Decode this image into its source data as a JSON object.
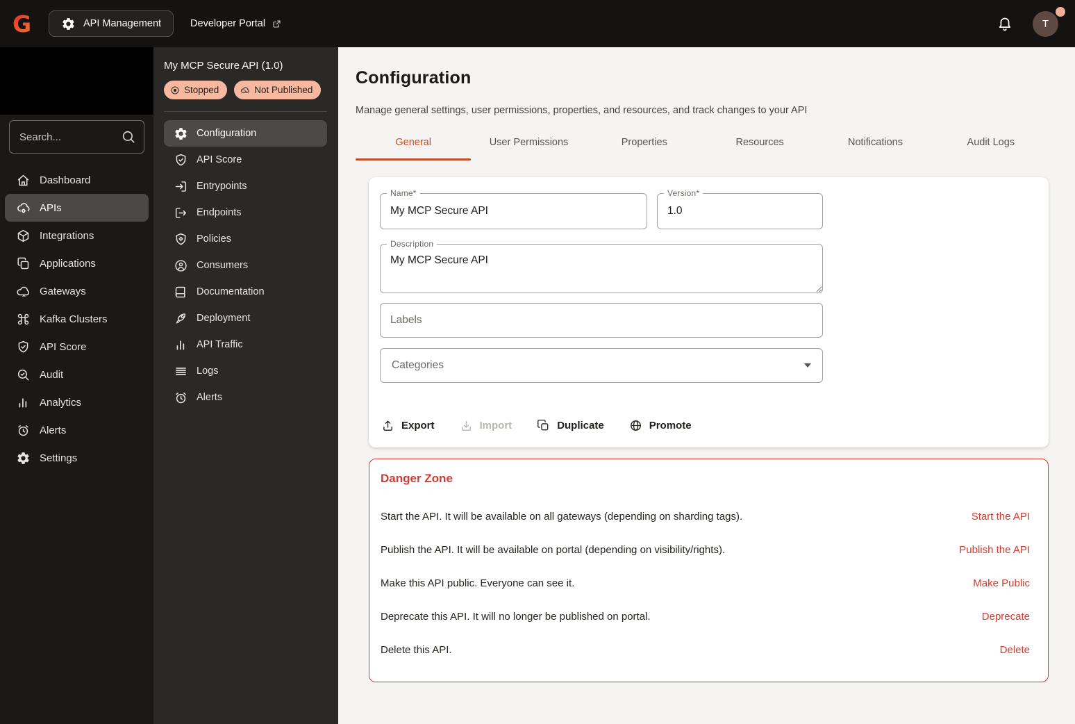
{
  "colors": {
    "accent_orange": "#c44e27",
    "danger_red": "#d23b30",
    "badge_bg": "#f6b9a0",
    "topbar_bg": "#151311",
    "sidebar_bg": "#1a1918",
    "subsidebar_bg": "#2b2928",
    "avatar_bg": "#5d4a42",
    "presence_dot": "#f2b094"
  },
  "topbar": {
    "logo_letter": "G",
    "app_switcher": {
      "label": "API Management",
      "icon": "gear"
    },
    "portal_link": {
      "label": "Developer Portal",
      "icon": "external-link"
    },
    "bell_icon": "bell",
    "avatar": {
      "initial": "T"
    }
  },
  "sidebar": {
    "search_placeholder": "Search...",
    "search_icon": "search",
    "items": [
      {
        "label": "Dashboard",
        "icon": "home",
        "active": false
      },
      {
        "label": "APIs",
        "icon": "cloud-gear",
        "active": true
      },
      {
        "label": "Integrations",
        "icon": "cube",
        "active": false
      },
      {
        "label": "Applications",
        "icon": "copies",
        "active": false
      },
      {
        "label": "Gateways",
        "icon": "cloud",
        "active": false
      },
      {
        "label": "Kafka Clusters",
        "icon": "command",
        "active": false
      },
      {
        "label": "API Score",
        "icon": "shield-check",
        "active": false
      },
      {
        "label": "Audit",
        "icon": "search-check",
        "active": false
      },
      {
        "label": "Analytics",
        "icon": "bar-chart",
        "active": false
      },
      {
        "label": "Alerts",
        "icon": "alarm",
        "active": false
      },
      {
        "label": "Settings",
        "icon": "gear",
        "active": false
      }
    ]
  },
  "api_menu": {
    "title": "My MCP Secure API (1.0)",
    "badges": [
      {
        "label": "Stopped",
        "icon": "stop-circle"
      },
      {
        "label": "Not Published",
        "icon": "cloud-off"
      }
    ],
    "items": [
      {
        "label": "Configuration",
        "icon": "gear",
        "active": true
      },
      {
        "label": "API Score",
        "icon": "shield-check",
        "active": false
      },
      {
        "label": "Entrypoints",
        "icon": "sign-in",
        "active": false
      },
      {
        "label": "Endpoints",
        "icon": "sign-out",
        "active": false
      },
      {
        "label": "Policies",
        "icon": "shield-gear",
        "active": false
      },
      {
        "label": "Consumers",
        "icon": "person",
        "active": false
      },
      {
        "label": "Documentation",
        "icon": "book",
        "active": false
      },
      {
        "label": "Deployment",
        "icon": "rocket",
        "active": false
      },
      {
        "label": "API Traffic",
        "icon": "bar-chart",
        "active": false
      },
      {
        "label": "Logs",
        "icon": "lines",
        "active": false
      },
      {
        "label": "Alerts",
        "icon": "alarm",
        "active": false
      }
    ]
  },
  "main": {
    "title": "Configuration",
    "subtitle": "Manage general settings, user permissions, properties, and resources, and track changes to your API",
    "tabs": [
      {
        "label": "General",
        "active": true
      },
      {
        "label": "User Permissions",
        "active": false
      },
      {
        "label": "Properties",
        "active": false
      },
      {
        "label": "Resources",
        "active": false
      },
      {
        "label": "Notifications",
        "active": false
      },
      {
        "label": "Audit Logs",
        "active": false
      }
    ],
    "form": {
      "name": {
        "label": "Name*",
        "value": "My MCP Secure API"
      },
      "version": {
        "label": "Version*",
        "value": "1.0"
      },
      "description": {
        "label": "Description",
        "value": "My MCP Secure API"
      },
      "labels": {
        "label": "Labels",
        "value": ""
      },
      "categories": {
        "label": "Categories",
        "value": ""
      }
    },
    "actions": [
      {
        "label": "Export",
        "icon": "upload",
        "disabled": false
      },
      {
        "label": "Import",
        "icon": "download",
        "disabled": true
      },
      {
        "label": "Duplicate",
        "icon": "copy",
        "disabled": false
      },
      {
        "label": "Promote",
        "icon": "globe",
        "disabled": false
      }
    ],
    "danger_zone": {
      "title": "Danger Zone",
      "rows": [
        {
          "text": "Start the API. It will be available on all gateways (depending on sharding tags).",
          "action": "Start the API"
        },
        {
          "text": "Publish the API. It will be available on portal (depending on visibility/rights).",
          "action": "Publish the API"
        },
        {
          "text": "Make this API public. Everyone can see it.",
          "action": "Make Public"
        },
        {
          "text": "Deprecate this API. It will no longer be published on portal.",
          "action": "Deprecate"
        },
        {
          "text": "Delete this API.",
          "action": "Delete"
        }
      ]
    }
  }
}
